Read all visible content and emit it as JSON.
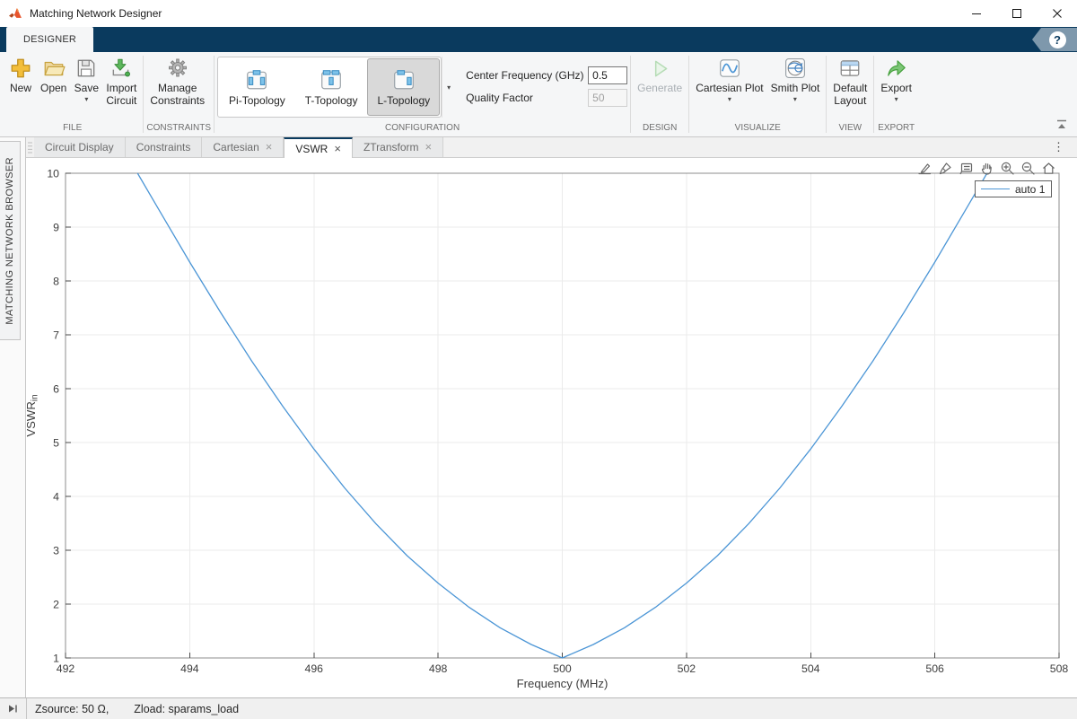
{
  "glyphs": {
    "close": "×",
    "dropdown": "▾",
    "kebab": "⋮",
    "help": "?"
  },
  "colors": {
    "accent_navy": "#0a3a5e",
    "line_blue": "#4c96d6",
    "selected_gray": "#d9d9d9"
  },
  "titlebar": {
    "title": "Matching Network Designer"
  },
  "ribbon": {
    "tab": "DESIGNER"
  },
  "toolstrip": {
    "file": {
      "caption": "FILE",
      "new": "New",
      "open": "Open",
      "save": "Save",
      "import": "Import\nCircuit"
    },
    "constraints": {
      "caption": "CONSTRAINTS",
      "manage": "Manage\nConstraints"
    },
    "configuration": {
      "caption": "CONFIGURATION",
      "pi": "Pi-Topology",
      "t": "T-Topology",
      "l": "L-Topology",
      "center_frequency_label": "Center Frequency (GHz)",
      "center_frequency_value": "0.5",
      "quality_factor_label": "Quality Factor",
      "quality_factor_value": "50"
    },
    "design": {
      "caption": "DESIGN",
      "generate": "Generate"
    },
    "visualize": {
      "caption": "VISUALIZE",
      "cartesian": "Cartesian Plot",
      "smith": "Smith Plot"
    },
    "view": {
      "caption": "VIEW",
      "default_layout": "Default\nLayout"
    },
    "export": {
      "caption": "EXPORT",
      "export": "Export"
    }
  },
  "browser_panel": {
    "label": "MATCHING NETWORK BROWSER"
  },
  "tabbar": {
    "tabs": [
      {
        "label": "Circuit Display",
        "closable": false,
        "active": false
      },
      {
        "label": "Constraints",
        "closable": false,
        "active": false
      },
      {
        "label": "Cartesian",
        "closable": true,
        "active": false
      },
      {
        "label": "VSWR",
        "closable": true,
        "active": true
      },
      {
        "label": "ZTransform",
        "closable": true,
        "active": false
      }
    ]
  },
  "axes_toolbar": {
    "icons": [
      "export",
      "brush",
      "datatips",
      "pan",
      "zoom-in",
      "zoom-out",
      "home"
    ]
  },
  "statusbar": {
    "zsource": "Zsource: 50 Ω,",
    "zload": "Zload: sparams_load"
  },
  "chart_data": {
    "type": "line",
    "title": "",
    "xlabel": "Frequency (MHz)",
    "ylabel": "VSWR",
    "ylabel_sub": "in",
    "xlim": [
      492,
      508
    ],
    "ylim": [
      1,
      10
    ],
    "xticks": [
      492,
      494,
      496,
      498,
      500,
      502,
      504,
      506,
      508
    ],
    "yticks": [
      1,
      2,
      3,
      4,
      5,
      6,
      7,
      8,
      9,
      10
    ],
    "grid": true,
    "legend": {
      "position": "northeast",
      "entries": [
        {
          "label": "auto 1",
          "color": "#4c96d6"
        }
      ]
    },
    "series": [
      {
        "name": "auto 1",
        "color": "#4c96d6",
        "x": [
          493.16,
          493.5,
          494,
          494.5,
          495,
          495.5,
          496,
          496.5,
          497,
          497.5,
          498,
          498.5,
          499,
          499.5,
          500,
          500.5,
          501,
          501.5,
          502,
          502.5,
          503,
          503.5,
          504,
          504.5,
          505,
          505.5,
          506,
          506.5,
          506.84
        ],
        "y": [
          10,
          9.33,
          8.35,
          7.41,
          6.51,
          5.67,
          4.88,
          4.15,
          3.49,
          2.9,
          2.39,
          1.94,
          1.56,
          1.25,
          1.0,
          1.25,
          1.56,
          1.94,
          2.39,
          2.9,
          3.49,
          4.15,
          4.88,
          5.67,
          6.51,
          7.41,
          8.35,
          9.33,
          10
        ]
      }
    ]
  }
}
